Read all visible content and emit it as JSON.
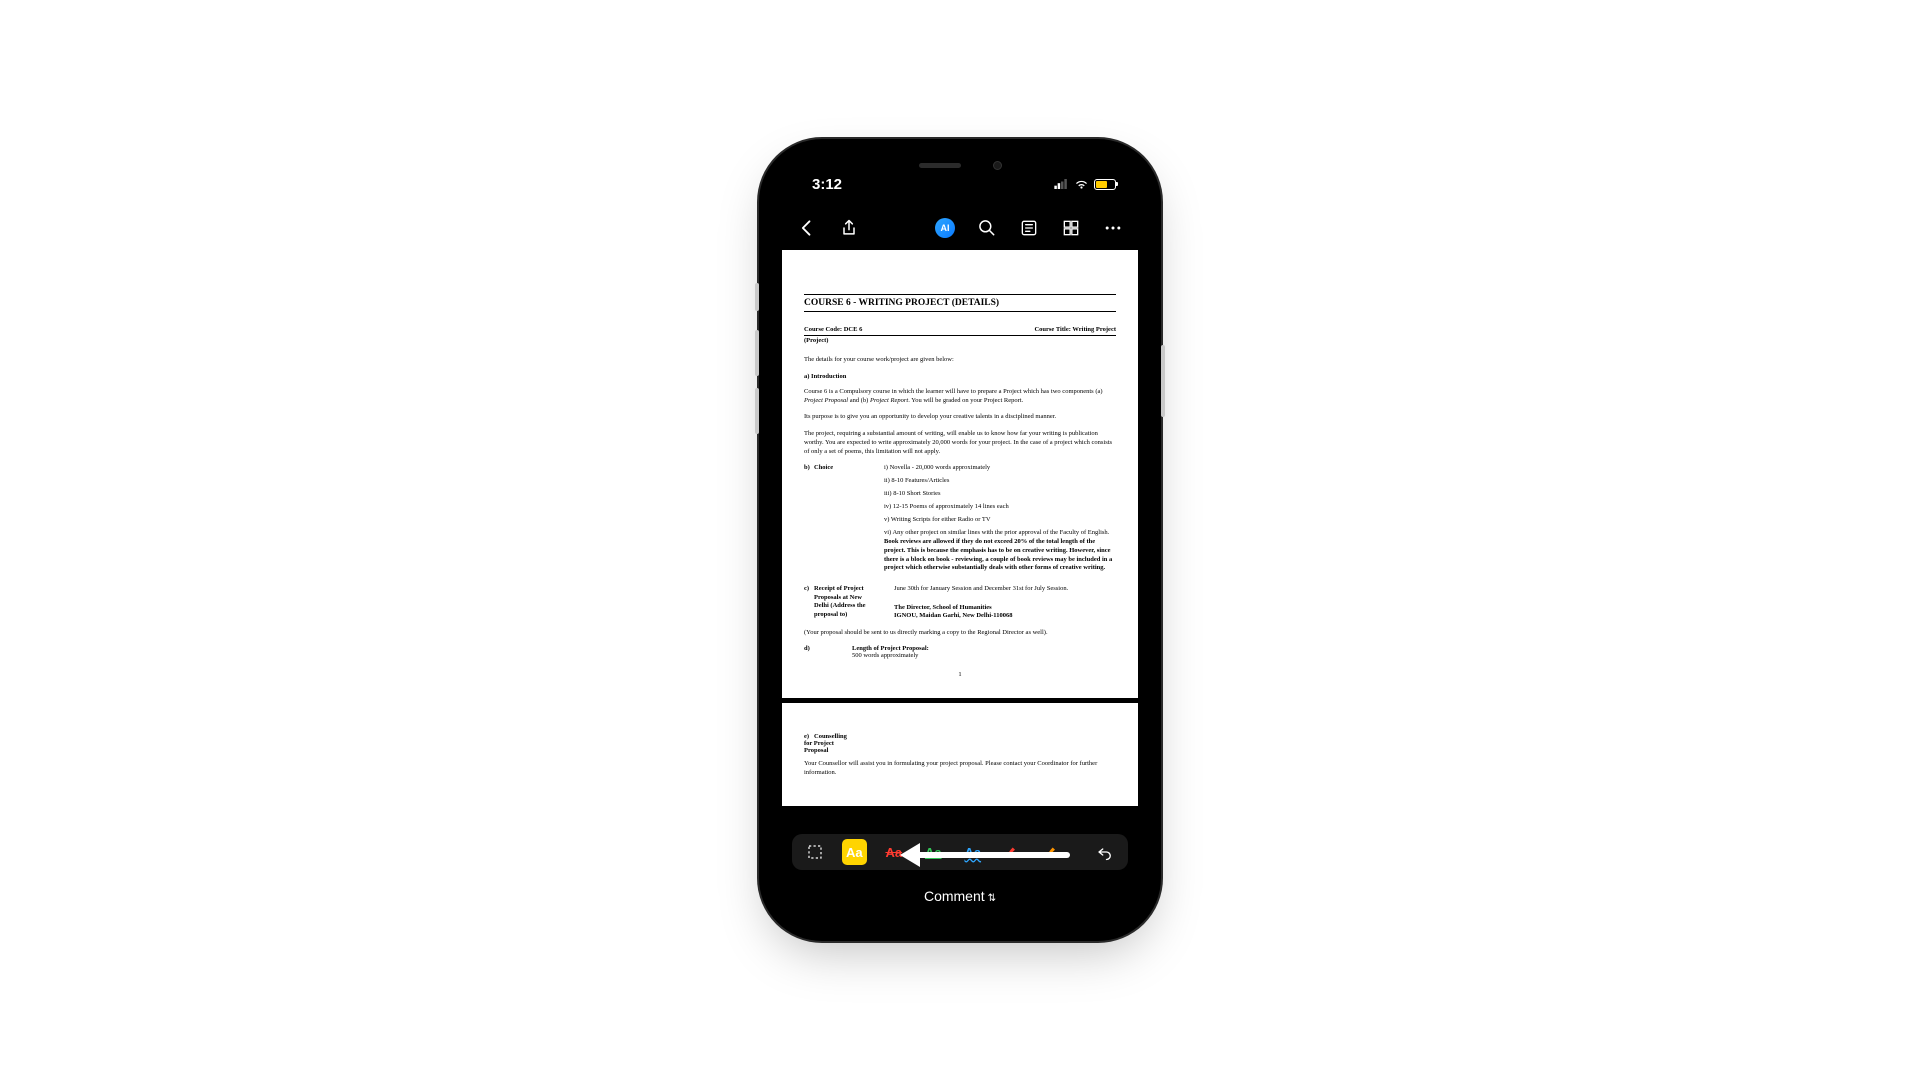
{
  "status": {
    "time": "3:12",
    "battery_pct": 55
  },
  "toolbar": {
    "ai_label": "AI"
  },
  "document": {
    "title": "COURSE 6 - WRITING PROJECT (DETAILS)",
    "course_code_label": "Course Code: DCE 6",
    "course_title_label": "Course Title: Writing Project",
    "project_label": "(Project)",
    "details_intro": "The details for your course work/project are given below:",
    "section_a": "a) Introduction",
    "para1_a": "Course 6 is a Compulsory course in which the learner will have to prepare a Project which has two components (a) ",
    "para1_italic_a": "Project Proposal",
    "para1_b": " and (b) ",
    "para1_italic_b": "Project Report",
    "para1_c": ". You will be graded on your Project Report.",
    "para2": "Its purpose is to give you an opportunity to develop your creative talents in a disciplined manner.",
    "para3": "The project, requiring a substantial amount of writing, will enable us to know how far your writing is publication worthy. You are expected to write approximately 20,000 words for your project. In the case of a project which consists of only a set of poems, this limitation will not apply.",
    "choice_label": "b)",
    "choice_word": "Choice",
    "choices": [
      "i) Novella - 20,000 words approximately",
      "ii) 8-10 Features/Articles",
      "iii) 8-10 Short Stories",
      "iv) 12-15 Poems of approximately 14 lines each",
      "v) Writing Scripts for either Radio or TV"
    ],
    "choice_vi_a": "vi) Any other project on similar lines with the prior approval of the Faculty of English. ",
    "choice_vi_bold": "Book reviews are allowed if they do not exceed 20% of the total length of the project. This is because the emphasis has to be on creative writing. However, since there is a block on book - reviewing, a couple of book reviews may be included in a project which otherwise substantially deals with other forms of creative writing.",
    "receipt_label_letter": "c)",
    "receipt_label": "Receipt of Project Proposals at New Delhi (Address the proposal to)",
    "receipt_dates": "June 30th for January Session and December 31st for July Session.",
    "receipt_addr1": "The Director, School of Humanities",
    "receipt_addr2": "IGNOU, Maidan Garhi, New Delhi-110068",
    "receipt_note": "(Your proposal should be sent to us directly marking a copy to the Regional Director as well).",
    "length_label_letter": "d)",
    "length_label": "Length of Project Proposal:",
    "length_value": "500 words approximately",
    "page_num": "1",
    "page2_head_letter": "e)",
    "page2_head": "Counselling for Project Proposal",
    "page2_para": "Your Counsellor will assist you in formulating your project proposal. Please contact your Coordinator for further information."
  },
  "tools": {
    "highlight": "Aa",
    "strike": "Aa",
    "underline": "Aa",
    "squiggly": "Aa"
  },
  "comment_label": "Comment"
}
